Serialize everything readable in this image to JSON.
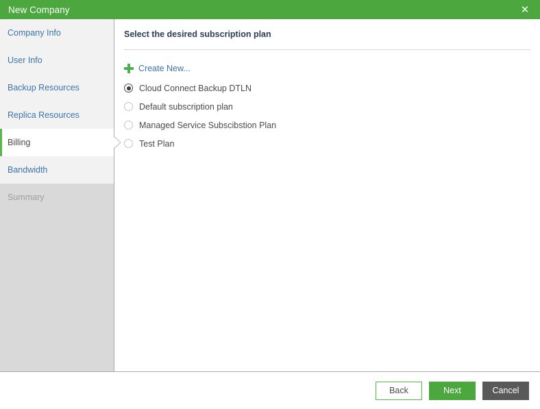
{
  "window": {
    "title": "New Company",
    "close_icon": "close-icon",
    "close_glyph": "✕"
  },
  "sidebar": {
    "items": [
      {
        "label": "Company Info",
        "state": "enabled"
      },
      {
        "label": "User Info",
        "state": "enabled"
      },
      {
        "label": "Backup Resources",
        "state": "enabled"
      },
      {
        "label": "Replica Resources",
        "state": "enabled"
      },
      {
        "label": "Billing",
        "state": "active"
      },
      {
        "label": "Bandwidth",
        "state": "enabled"
      },
      {
        "label": "Summary",
        "state": "disabled"
      }
    ]
  },
  "content": {
    "heading": "Select the desired subscription plan",
    "create_new": {
      "label": "Create New...",
      "icon": "plus-icon"
    },
    "plans": [
      {
        "label": "Cloud Connect Backup DTLN",
        "selected": true
      },
      {
        "label": "Default subscription plan",
        "selected": false
      },
      {
        "label": "Managed Service Subscibstion Plan",
        "selected": false
      },
      {
        "label": "Test Plan",
        "selected": false
      }
    ]
  },
  "footer": {
    "back_label": "Back",
    "next_label": "Next",
    "cancel_label": "Cancel"
  },
  "colors": {
    "brand_green": "#4ca73f",
    "accent_green": "#54b948",
    "link_blue": "#3b74ab",
    "cancel_gray": "#595959",
    "sidebar_step_bg": "#f2f2f2",
    "sidebar_disabled_bg": "#d9d9d9",
    "heading_navy": "#2c3e55"
  }
}
